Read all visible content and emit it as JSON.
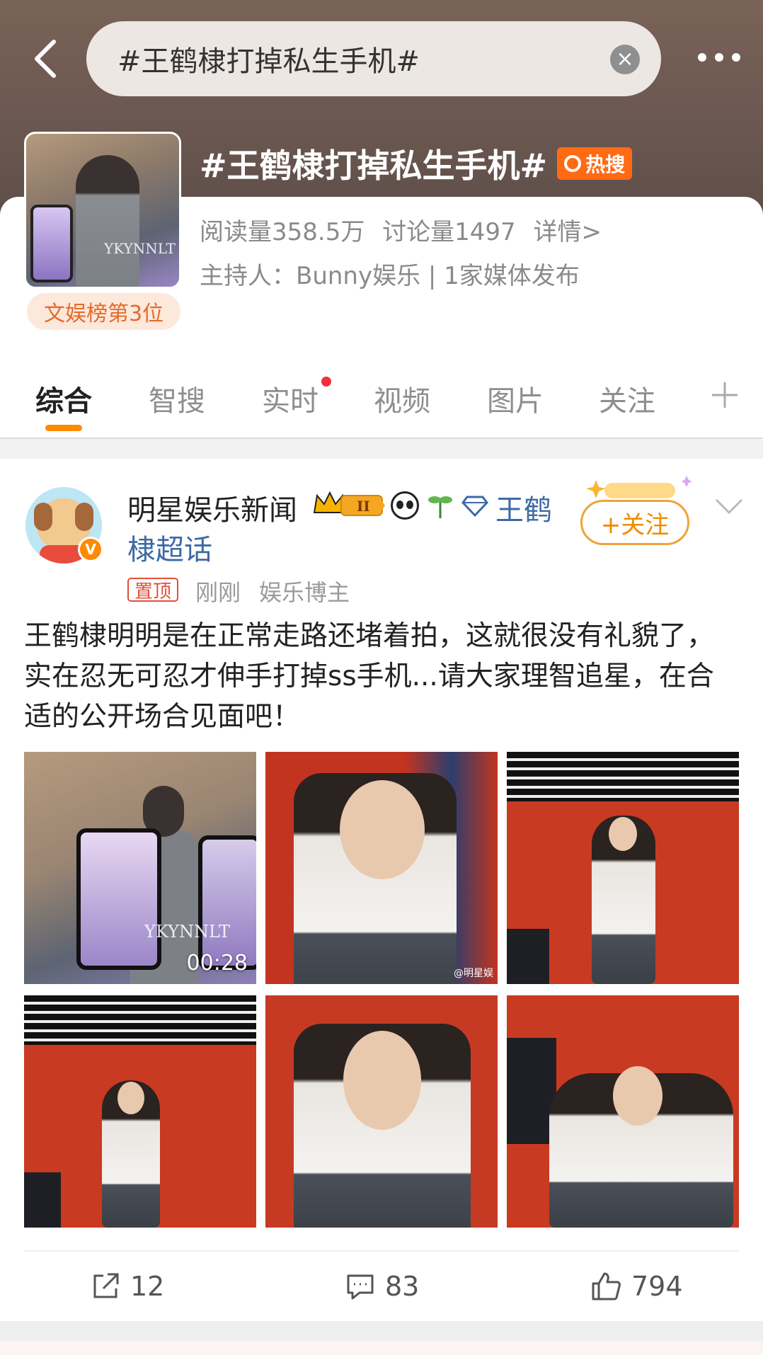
{
  "header": {
    "search_text": "#王鹤棣打掉私生手机#",
    "clear_icon": "close-circle-icon",
    "back_icon": "chevron-left-icon",
    "more_icon": "more-dots-icon"
  },
  "topic": {
    "title": "#王鹤棣打掉私生手机#",
    "hot_label": "热搜",
    "reads": "阅读量358.5万",
    "discussions": "讨论量1497",
    "details": "详情>",
    "host_line": "主持人：Bunny娱乐 | 1家媒体发布",
    "rank": "文娱榜第3位",
    "thumb_watermark": "YKYNNLT"
  },
  "tabs": [
    {
      "label": "综合",
      "active": true
    },
    {
      "label": "智搜"
    },
    {
      "label": "实时",
      "dot": true
    },
    {
      "label": "视频"
    },
    {
      "label": "图片"
    },
    {
      "label": "关注"
    }
  ],
  "post": {
    "author": "明星娱乐新闻",
    "level_badge": "II",
    "supertopic_line1": "王鹤",
    "supertopic_line2": "棣超话",
    "follow_label": "+关注",
    "pin_label": "置顶",
    "time": "刚刚",
    "role": "娱乐博主",
    "verified_letter": "V",
    "text": "王鹤棣明明是在正常走路还堵着拍，这就很没有礼貌了，实在忍无可忍才伸手打掉ss手机...请大家理智追星，在合适的公开场合见面吧！",
    "video_duration": "00:28",
    "video_watermark": "YKYNNLT",
    "image_watermark": "@明星娱",
    "actions": {
      "share": "12",
      "comments": "83",
      "likes": "794"
    }
  },
  "colors": {
    "accent_orange": "#ff8a00",
    "link_blue": "#3d6aa6",
    "hot_orange": "#ff6a13"
  }
}
